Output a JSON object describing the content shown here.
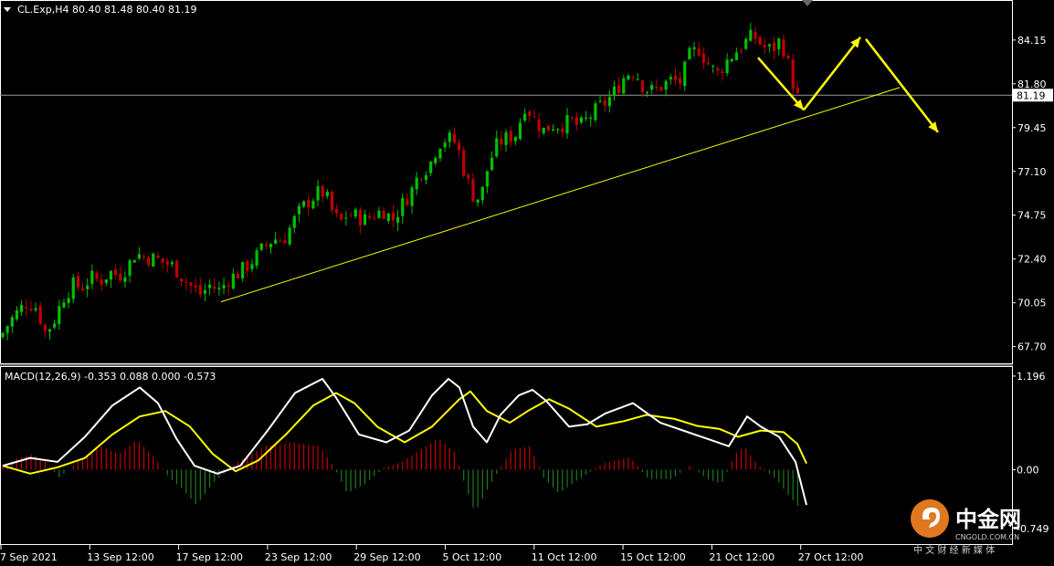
{
  "chart_header": {
    "symbol_line": "CL.Exp,H4  80.40 81.48 80.40 81.19",
    "macd_line": "MACD(12,26,9) -0.353 0.088 0.000 -0.573"
  },
  "colors": {
    "background": "#000000",
    "bull_candle": "#00c000",
    "bear_candle": "#c00000",
    "trendline": "#ffff00",
    "macd_line": "#ffffff",
    "signal_line": "#ffff00",
    "axis_text": "#ffffff"
  },
  "watermark": {
    "brand_cn": "中金网",
    "brand_en": "CNGOLD.COM.CN",
    "subtitle": "中 文 财 经 新 媒 体"
  },
  "chart_data": [
    {
      "type": "candlestick",
      "title": "CL.Exp,H4",
      "ohlc_last": {
        "open": 80.4,
        "high": 81.48,
        "low": 80.4,
        "close": 81.19
      },
      "current_price_label": "81.19",
      "y_ticks": [
        "84.15",
        "81.80",
        "79.45",
        "77.10",
        "74.75",
        "72.40",
        "70.05",
        "67.70"
      ],
      "ylim": [
        66.8,
        86.2
      ],
      "x_ticks": [
        "7 Sep 2021",
        "13 Sep 12:00",
        "17 Sep 12:00",
        "23 Sep 12:00",
        "29 Sep 12:00",
        "5 Oct 12:00",
        "11 Oct 12:00",
        "15 Oct 12:00",
        "21 Oct 12:00",
        "27 Oct 12:00"
      ],
      "close_path": [
        [
          0,
          68.2
        ],
        [
          10,
          69.0
        ],
        [
          20,
          69.6
        ],
        [
          30,
          70.1
        ],
        [
          40,
          69.8
        ],
        [
          50,
          68.4
        ],
        [
          60,
          69.2
        ],
        [
          70,
          70.4
        ],
        [
          80,
          71.0
        ],
        [
          90,
          70.9
        ],
        [
          100,
          71.4
        ],
        [
          110,
          71.2
        ],
        [
          120,
          71.7
        ],
        [
          130,
          71.5
        ],
        [
          140,
          72.0
        ],
        [
          148,
          72.7
        ],
        [
          160,
          72.5
        ],
        [
          170,
          72.4
        ],
        [
          180,
          72.2
        ],
        [
          190,
          72.0
        ],
        [
          200,
          71.4
        ],
        [
          210,
          70.9
        ],
        [
          220,
          70.5
        ],
        [
          230,
          71.0
        ],
        [
          240,
          70.7
        ],
        [
          250,
          71.3
        ],
        [
          260,
          71.6
        ],
        [
          270,
          72.0
        ],
        [
          280,
          72.5
        ],
        [
          290,
          73.1
        ],
        [
          300,
          73.5
        ],
        [
          310,
          73.4
        ],
        [
          320,
          74.3
        ],
        [
          330,
          75.1
        ],
        [
          340,
          75.6
        ],
        [
          350,
          76.0
        ],
        [
          356,
          75.9
        ],
        [
          362,
          75.1
        ],
        [
          372,
          74.3
        ],
        [
          380,
          74.8
        ],
        [
          390,
          74.7
        ],
        [
          400,
          74.5
        ],
        [
          410,
          74.8
        ],
        [
          420,
          75.0
        ],
        [
          430,
          74.5
        ],
        [
          440,
          75.3
        ],
        [
          450,
          76.0
        ],
        [
          460,
          77.1
        ],
        [
          470,
          77.4
        ],
        [
          480,
          78.6
        ],
        [
          490,
          78.9
        ],
        [
          500,
          78.6
        ],
        [
          510,
          76.8
        ],
        [
          520,
          75.6
        ],
        [
          527,
          75.8
        ],
        [
          535,
          77.5
        ],
        [
          545,
          78.6
        ],
        [
          555,
          78.9
        ],
        [
          565,
          79.1
        ],
        [
          575,
          80.7
        ],
        [
          585,
          79.9
        ],
        [
          595,
          79.3
        ],
        [
          605,
          79.6
        ],
        [
          615,
          79.6
        ],
        [
          625,
          79.8
        ],
        [
          635,
          79.5
        ],
        [
          645,
          80.0
        ],
        [
          655,
          80.5
        ],
        [
          665,
          80.9
        ],
        [
          675,
          81.5
        ],
        [
          685,
          82.3
        ],
        [
          695,
          82.5
        ],
        [
          705,
          81.6
        ],
        [
          715,
          81.4
        ],
        [
          725,
          81.7
        ],
        [
          735,
          82.0
        ],
        [
          745,
          81.9
        ],
        [
          755,
          83.3
        ],
        [
          765,
          83.7
        ],
        [
          775,
          82.9
        ],
        [
          785,
          82.3
        ],
        [
          795,
          83.0
        ],
        [
          805,
          83.5
        ],
        [
          815,
          84.0
        ],
        [
          825,
          84.4
        ],
        [
          835,
          83.8
        ],
        [
          845,
          83.6
        ],
        [
          855,
          84.2
        ],
        [
          865,
          82.5
        ],
        [
          872,
          81.1
        ],
        [
          880,
          80.8
        ]
      ],
      "annotations": {
        "support_trendline": [
          [
            12,
            70.1
          ],
          [
            155,
            81.6
          ]
        ],
        "projection_arrows": [
          [
            [
              52,
              83.2
            ],
            [
              55.5,
              80.4
            ]
          ],
          [
            [
              55.5,
              80.4
            ],
            [
              59.8,
              84.3
            ]
          ],
          [
            [
              60.5,
              84.2
            ],
            [
              65.6,
              79.2
            ]
          ]
        ]
      }
    },
    {
      "type": "macd",
      "title": "MACD(12,26,9)",
      "values_last": {
        "macd": -0.353,
        "signal": 0.088,
        "hist_a": 0.0,
        "hist_b": -0.573
      },
      "y_ticks": [
        "1.196",
        "0.00",
        "-0.749"
      ],
      "ylim": [
        -0.95,
        1.3
      ],
      "macd_path": [
        [
          0,
          0.05
        ],
        [
          30,
          0.15
        ],
        [
          60,
          0.1
        ],
        [
          90,
          0.42
        ],
        [
          120,
          0.82
        ],
        [
          150,
          1.05
        ],
        [
          170,
          0.85
        ],
        [
          190,
          0.4
        ],
        [
          210,
          0.05
        ],
        [
          235,
          -0.05
        ],
        [
          260,
          0.05
        ],
        [
          290,
          0.5
        ],
        [
          320,
          0.98
        ],
        [
          350,
          1.16
        ],
        [
          365,
          0.92
        ],
        [
          390,
          0.45
        ],
        [
          420,
          0.35
        ],
        [
          445,
          0.5
        ],
        [
          470,
          0.95
        ],
        [
          488,
          1.16
        ],
        [
          500,
          1.05
        ],
        [
          515,
          0.55
        ],
        [
          530,
          0.35
        ],
        [
          545,
          0.7
        ],
        [
          565,
          0.95
        ],
        [
          580,
          1.02
        ],
        [
          595,
          0.88
        ],
        [
          620,
          0.55
        ],
        [
          640,
          0.58
        ],
        [
          660,
          0.72
        ],
        [
          690,
          0.85
        ],
        [
          720,
          0.6
        ],
        [
          745,
          0.5
        ],
        [
          770,
          0.4
        ],
        [
          795,
          0.3
        ],
        [
          815,
          0.68
        ],
        [
          830,
          0.55
        ],
        [
          850,
          0.42
        ],
        [
          868,
          0.1
        ],
        [
          880,
          -0.45
        ]
      ],
      "signal_path": [
        [
          0,
          0.05
        ],
        [
          30,
          -0.05
        ],
        [
          60,
          0.03
        ],
        [
          90,
          0.15
        ],
        [
          120,
          0.45
        ],
        [
          150,
          0.68
        ],
        [
          178,
          0.75
        ],
        [
          205,
          0.55
        ],
        [
          230,
          0.2
        ],
        [
          255,
          -0.02
        ],
        [
          280,
          0.12
        ],
        [
          310,
          0.45
        ],
        [
          340,
          0.82
        ],
        [
          365,
          0.98
        ],
        [
          385,
          0.85
        ],
        [
          410,
          0.55
        ],
        [
          440,
          0.35
        ],
        [
          470,
          0.55
        ],
        [
          500,
          0.9
        ],
        [
          512,
          1.0
        ],
        [
          530,
          0.75
        ],
        [
          555,
          0.6
        ],
        [
          575,
          0.75
        ],
        [
          598,
          0.9
        ],
        [
          620,
          0.78
        ],
        [
          650,
          0.55
        ],
        [
          680,
          0.62
        ],
        [
          705,
          0.7
        ],
        [
          735,
          0.65
        ],
        [
          760,
          0.56
        ],
        [
          785,
          0.52
        ],
        [
          805,
          0.42
        ],
        [
          830,
          0.5
        ],
        [
          855,
          0.48
        ],
        [
          870,
          0.33
        ],
        [
          880,
          0.08
        ]
      ],
      "hist_path": [
        [
          0,
          0.02
        ],
        [
          20,
          0.15
        ],
        [
          35,
          0.2
        ],
        [
          50,
          0.1
        ],
        [
          65,
          -0.1
        ],
        [
          85,
          0.1
        ],
        [
          110,
          0.3
        ],
        [
          130,
          0.2
        ],
        [
          150,
          0.38
        ],
        [
          170,
          0.15
        ],
        [
          185,
          -0.1
        ],
        [
          200,
          -0.25
        ],
        [
          215,
          -0.45
        ],
        [
          235,
          -0.15
        ],
        [
          260,
          0.1
        ],
        [
          290,
          0.3
        ],
        [
          320,
          0.35
        ],
        [
          350,
          0.3
        ],
        [
          365,
          0.05
        ],
        [
          380,
          -0.3
        ],
        [
          400,
          -0.18
        ],
        [
          420,
          0.02
        ],
        [
          440,
          0.1
        ],
        [
          460,
          0.25
        ],
        [
          480,
          0.4
        ],
        [
          498,
          0.22
        ],
        [
          508,
          -0.15
        ],
        [
          520,
          -0.55
        ],
        [
          535,
          -0.22
        ],
        [
          560,
          0.25
        ],
        [
          580,
          0.3
        ],
        [
          595,
          -0.1
        ],
        [
          612,
          -0.3
        ],
        [
          630,
          -0.15
        ],
        [
          660,
          0.08
        ],
        [
          690,
          0.16
        ],
        [
          710,
          -0.12
        ],
        [
          735,
          -0.12
        ],
        [
          755,
          0.05
        ],
        [
          775,
          -0.12
        ],
        [
          790,
          -0.18
        ],
        [
          805,
          0.2
        ],
        [
          815,
          0.3
        ],
        [
          830,
          0.05
        ],
        [
          850,
          -0.12
        ],
        [
          865,
          -0.35
        ],
        [
          880,
          -0.55
        ]
      ]
    }
  ]
}
